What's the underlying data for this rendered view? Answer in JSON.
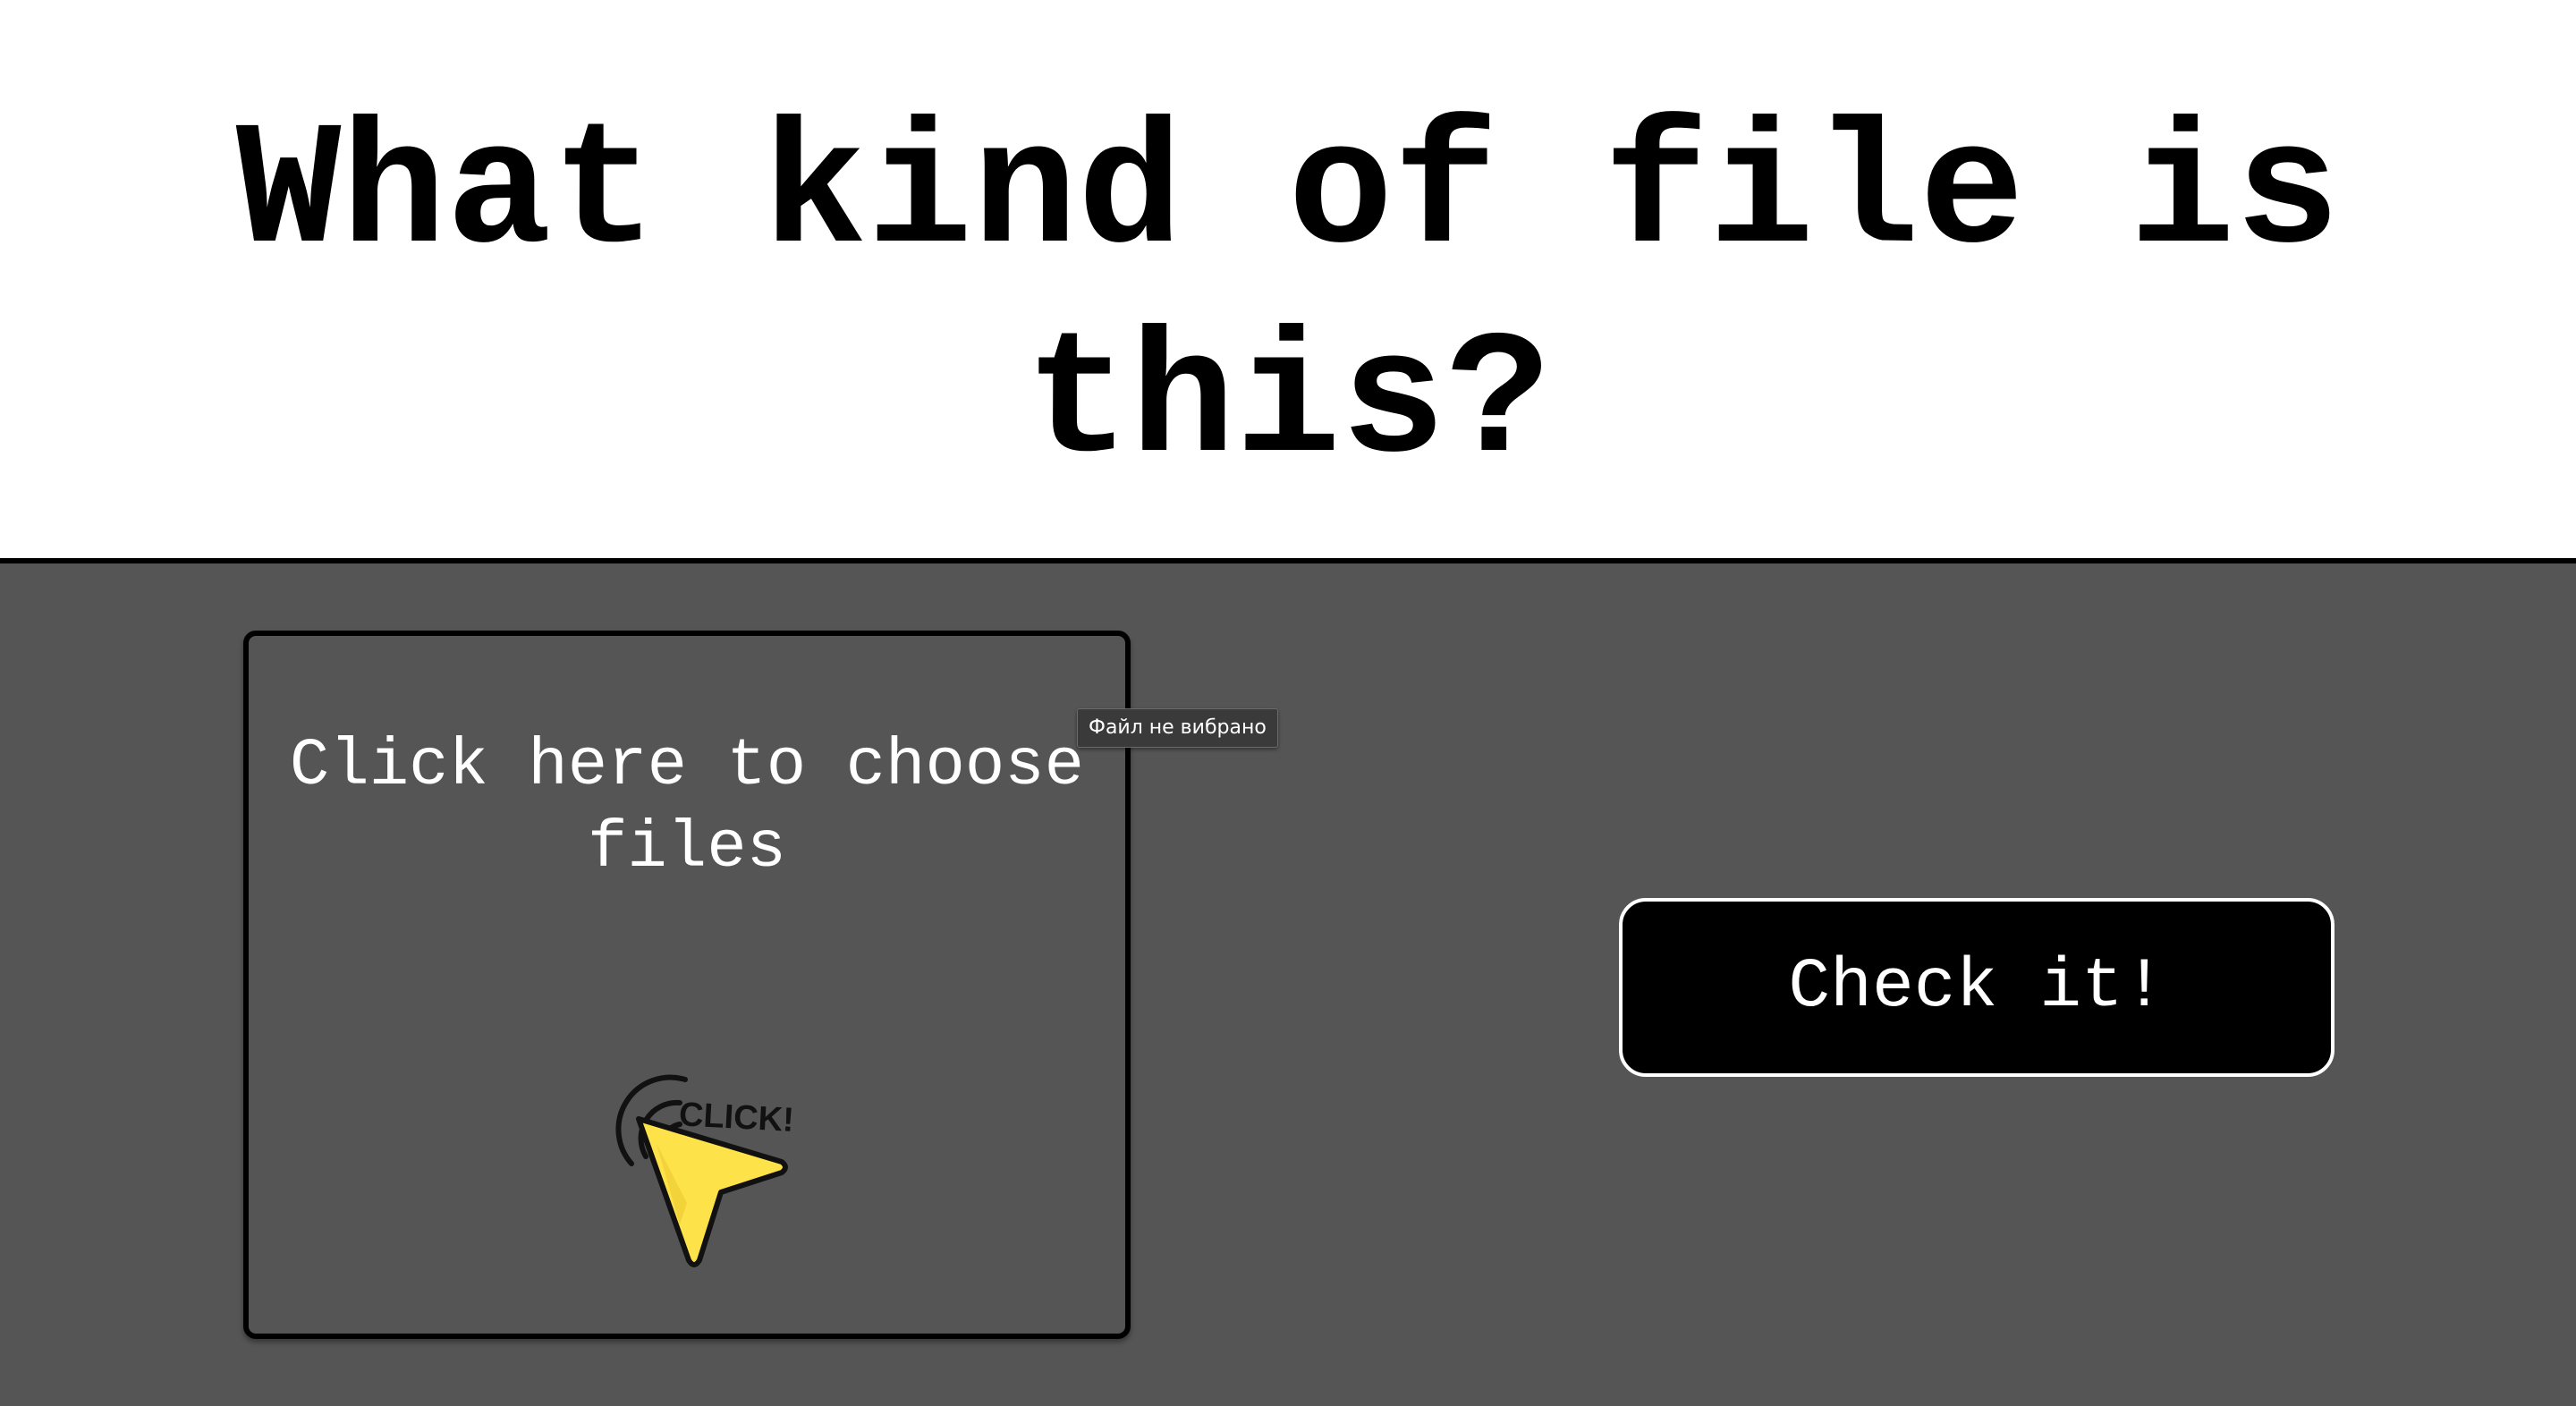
{
  "header": {
    "title": "What kind of file is this?"
  },
  "file_picker": {
    "label": "Click here to choose files",
    "illustration_text": "CLICK!",
    "illustration_icon": "click-cursor-icon",
    "tooltip": "Файл не вибрано"
  },
  "actions": {
    "check_label": "Check it!"
  },
  "colors": {
    "header_background": "#ffffff",
    "main_background": "#555555",
    "button_background": "#000000",
    "cursor_fill": "#fde24a",
    "text_light": "#ffffff",
    "text_dark": "#000000"
  }
}
